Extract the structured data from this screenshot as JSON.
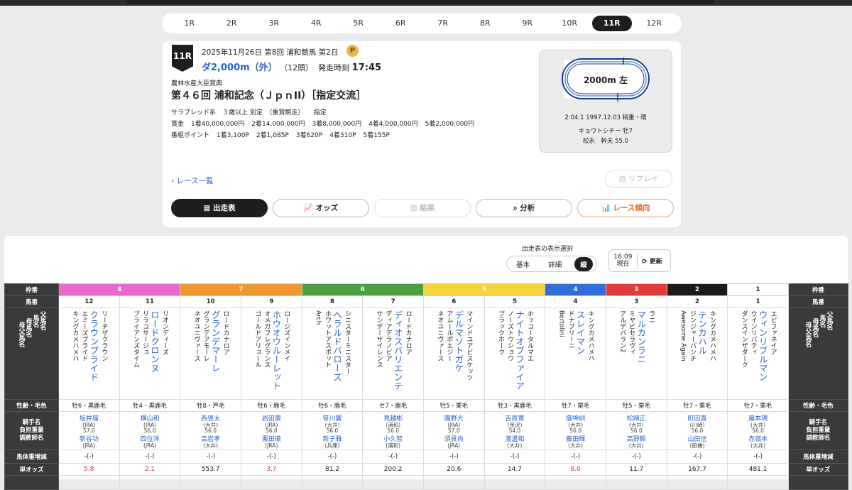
{
  "race_tabs": [
    "1R",
    "2R",
    "3R",
    "4R",
    "5R",
    "6R",
    "7R",
    "8R",
    "9R",
    "10R",
    "11R",
    "12R"
  ],
  "active_tab": "11R",
  "race": {
    "badge": "11R",
    "date_line": "2025年11月26日  第8回 浦和競馬 第2日",
    "point_icon": "P",
    "distance": "ダ2,000m（外）",
    "heads": "（12頭）",
    "start_label": "発走時刻",
    "start_time": "17:45",
    "sponsor": "農林水産大臣賞典",
    "title": "第４６回 浦和記念（ＪｐｎII）［指定交流］",
    "conditions": "サラブレッド系　３歳以上  別定　（重賞競走）　　指定",
    "prize_label": "賞金",
    "prizes": [
      "1着40,000,000円",
      "2着14,000,000円",
      "3着8,000,000円",
      "4着4,000,000円",
      "5着2,000,000円"
    ],
    "points_label": "番組ポイント",
    "points": [
      "1着3,100P",
      "2着1,085P",
      "3着620P",
      "4着310P",
      "5着155P"
    ]
  },
  "course": {
    "label": "2000m 左",
    "record": "2:04.1  1997.12.03  稍重・晴",
    "horse": "キョウトシチー  牡7",
    "jockey": "松永　幹夫  55.0"
  },
  "nav": {
    "back": "‹ レース一覧",
    "replay": "リプレイ",
    "buttons": [
      "出走表",
      "オッズ",
      "結果",
      "分析",
      "レース傾向"
    ]
  },
  "view": {
    "label": "出走表の表示選択",
    "options": [
      "基本",
      "詳細",
      "縦"
    ],
    "selected": "縦",
    "time": "16:09",
    "time_sub": "現在",
    "refresh": "更新"
  },
  "row_headers": {
    "frame": "枠番",
    "number": "馬番",
    "names": [
      "父馬名",
      "馬名",
      "母馬名",
      "母父馬名"
    ],
    "sexage": "性齢・毛色",
    "jockey": [
      "騎手名",
      "負担重量",
      "調教師名"
    ],
    "weight": "馬体重増減",
    "odds": "単オッズ"
  },
  "frames": [
    {
      "n": "8",
      "color": "#e868d0",
      "span": 2
    },
    {
      "n": "7",
      "color": "#f0962e",
      "span": 2
    },
    {
      "n": "6",
      "color": "#4aa040",
      "span": 2
    },
    {
      "n": "5",
      "color": "#f5d33a",
      "span": 2
    },
    {
      "n": "4",
      "color": "#2f6fdc",
      "span": 1
    },
    {
      "n": "3",
      "color": "#e03a3a",
      "span": 1
    },
    {
      "n": "2",
      "color": "#1a1a1a",
      "span": 1
    },
    {
      "n": "1",
      "color": "#ffffff",
      "span": 1
    }
  ],
  "horses": [
    {
      "no": "12",
      "sire": "リーチザクラウン",
      "name": "クラウンプライド",
      "dam": "エミーズプライド",
      "damsire": "キングカメハメハ",
      "sexage": "牡6・黒鹿毛",
      "jockey": "坂井瑠",
      "jaff": "(JRA)",
      "wt": "57.0",
      "trainer": "新谷功",
      "taff": "(JRA)",
      "bw": "-(-)",
      "odds": "5.8",
      "hot": true
    },
    {
      "no": "11",
      "sire": "リオンディーズ",
      "name": "ロードクロンヌ",
      "dam": "リラコサージュ",
      "damsire": "ブライアンズタイム",
      "sexage": "牡4・黒鹿毛",
      "jockey": "横山和",
      "jaff": "(JRA)",
      "wt": "56.0",
      "trainer": "四位洋",
      "taff": "(JRA)",
      "bw": "-(-)",
      "odds": "2.1",
      "hot": true
    },
    {
      "no": "10",
      "sire": "ロードカナロア",
      "name": "グランデマーレ",
      "dam": "グランデアモーレ",
      "damsire": "ネオユニヴァース",
      "sexage": "牡8・芦毛",
      "jockey": "西啓太",
      "jaff": "(大井)",
      "wt": "56.0",
      "trainer": "高岩孝",
      "taff": "(大井)",
      "bw": "-(-)",
      "odds": "553.7",
      "hot": false
    },
    {
      "no": "9",
      "sire": "ロージズインメイ",
      "name": "ホウオウルーレット",
      "dam": "オメガフレグランス",
      "damsire": "ゴールドアリュール",
      "sexage": "牡6・鹿毛",
      "jockey": "岩田康",
      "jaff": "(JRA)",
      "wt": "56.0",
      "trainer": "栗田徹",
      "taff": "(JRA)",
      "bw": "-(-)",
      "odds": "3.7",
      "hot": true
    },
    {
      "no": "8",
      "sire": "シニスターミニスター",
      "name": "ヘラルドバローズ",
      "dam": "ホワットアスポット",
      "damsire": "Arch",
      "sexage": "牡6・鹿毛",
      "jockey": "笹川翼",
      "jaff": "(大井)",
      "wt": "56.0",
      "trainer": "新子雅",
      "taff": "(兵庫)",
      "bw": "-(-)",
      "odds": "81.2",
      "hot": false
    },
    {
      "no": "7",
      "sire": "ロードカナロア",
      "name": "ディオスバリエンテ",
      "dam": "ディアデラノビア",
      "damsire": "サンデーサイレンス",
      "sexage": "セ7・鹿毛",
      "jockey": "見越彬",
      "jaff": "(浦和)",
      "wt": "56.0",
      "trainer": "小久智",
      "taff": "(浦和)",
      "bw": "-(-)",
      "odds": "200.2",
      "hot": false
    },
    {
      "no": "6",
      "sire": "マインドユアビスケッツ",
      "name": "デルマソトガケ",
      "dam": "アムールポエジー",
      "damsire": "ネオユニヴァース",
      "sexage": "牡5・栗毛",
      "jockey": "團野大",
      "jaff": "(JRA)",
      "wt": "57.0",
      "trainer": "須貝尚",
      "taff": "(JRA)",
      "bw": "-(-)",
      "odds": "20.6",
      "hot": false
    },
    {
      "no": "5",
      "sire": "ホッコータルマエ",
      "name": "ナイトオブファイア",
      "dam": "ノーズトウショウ",
      "damsire": "ブラックホーク",
      "sexage": "牡3・黒鹿毛",
      "jockey": "吉原寛",
      "jaff": "(金沢)",
      "wt": "54.0",
      "trainer": "渡邊和",
      "taff": "(大井)",
      "bw": "-(-)",
      "odds": "14.7",
      "hot": false
    },
    {
      "no": "4",
      "sire": "キングカメハメハ",
      "name": "スレイマン",
      "dam": "ドナブリーニ",
      "damsire": "Bertolini",
      "sexage": "牡7・栗毛",
      "jockey": "御神訓",
      "jaff": "(大井)",
      "wt": "56.0",
      "trainer": "藤田輝",
      "taff": "(大井)",
      "bw": "-(-)",
      "odds": "8.0",
      "hot": true
    },
    {
      "no": "3",
      "sire": "ラニ",
      "name": "マルカンラニ",
      "dam": "ミヤビセラヴィ",
      "damsire": "アルデバラン2",
      "sexage": "牡5・栗毛",
      "jockey": "松崎正",
      "jaff": "(大井)",
      "wt": "56.0",
      "trainer": "高野毅",
      "taff": "(大井)",
      "bw": "-(-)",
      "odds": "11.7",
      "hot": false
    },
    {
      "no": "2",
      "sire": "キングカメハメハ",
      "name": "テンカハル",
      "dam": "ジンジャーパンチ",
      "damsire": "Awesome Again",
      "sexage": "牡7・栗毛",
      "jockey": "町田直",
      "jaff": "(川崎)",
      "wt": "56.0",
      "trainer": "山田信",
      "taff": "(船橋)",
      "bw": "-(-)",
      "odds": "167.7",
      "hot": false
    },
    {
      "no": "1",
      "sire": "エピファネイア",
      "name": "ウィンリブルマン",
      "dam": "ウインリバティ",
      "damsire": "ダンスインザダーク",
      "sexage": "牡7・栗毛",
      "jockey": "藤本現",
      "jaff": "(大井)",
      "wt": "56.0",
      "trainer": "赤嶺本",
      "taff": "(大井)",
      "bw": "-(-)",
      "odds": "481.1",
      "hot": false
    }
  ]
}
